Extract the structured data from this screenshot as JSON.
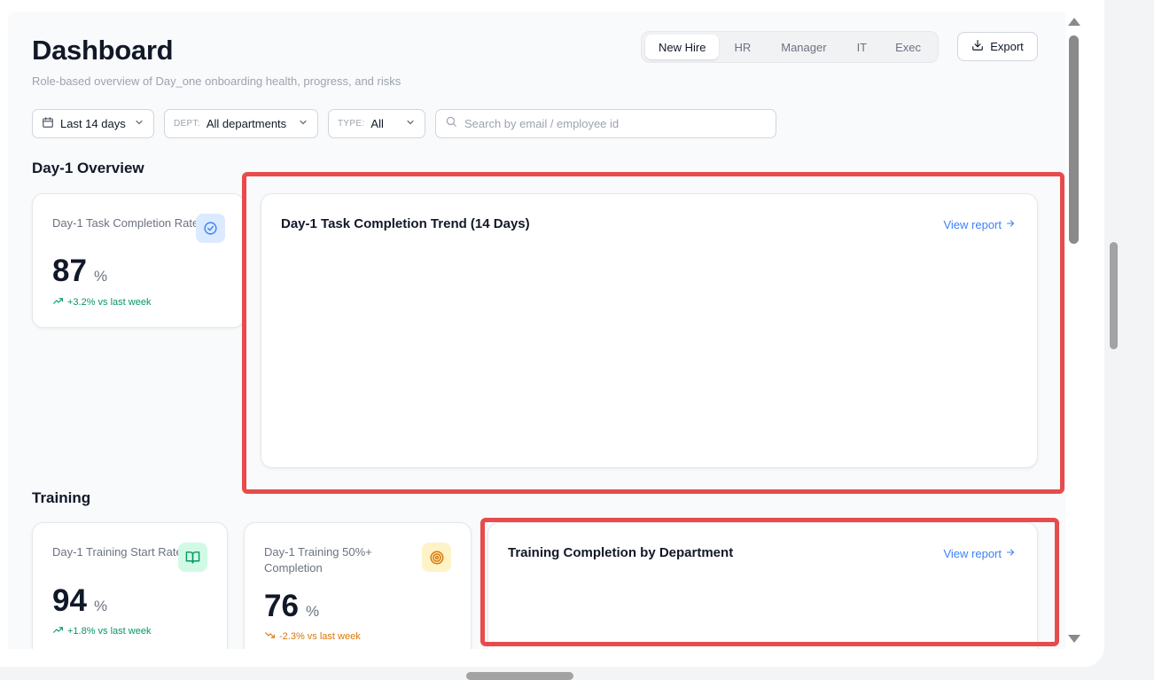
{
  "header": {
    "title": "Dashboard",
    "subtitle": "Role-based overview of Day_one onboarding health, progress, and risks"
  },
  "roles": [
    "New Hire",
    "HR",
    "Manager",
    "IT",
    "Exec"
  ],
  "active_role": "New Hire",
  "export_label": "Export",
  "filters": {
    "date": "Last 14 days",
    "dept_label": "DEPT:",
    "dept_value": "All departments",
    "type_label": "TYPE:",
    "type_value": "All",
    "search_placeholder": "Search by email / employee id"
  },
  "sections": {
    "overview": "Day-1 Overview",
    "training": "Training"
  },
  "metrics": {
    "task_completion": {
      "title": "Day-1 Task Completion Rate",
      "value": "87",
      "unit": "%",
      "delta": "+3.2% vs last week"
    },
    "training_start": {
      "title": "Day-1 Training Start Rate",
      "value": "94",
      "unit": "%",
      "delta": "+1.8% vs last week"
    },
    "training_50": {
      "title": "Day-1 Training 50%+ Completion",
      "value": "76",
      "unit": "%",
      "delta": "-2.3% vs last week"
    }
  },
  "charts": {
    "trend": {
      "title": "Day-1 Task Completion Trend (14 Days)",
      "link": "View report"
    },
    "dept": {
      "title": "Training Completion by Department",
      "link": "View report"
    }
  },
  "colors": {
    "accent": "#3b82f6",
    "positive": "#059669",
    "negative": "#d97706",
    "highlight": "#e84b4b"
  }
}
